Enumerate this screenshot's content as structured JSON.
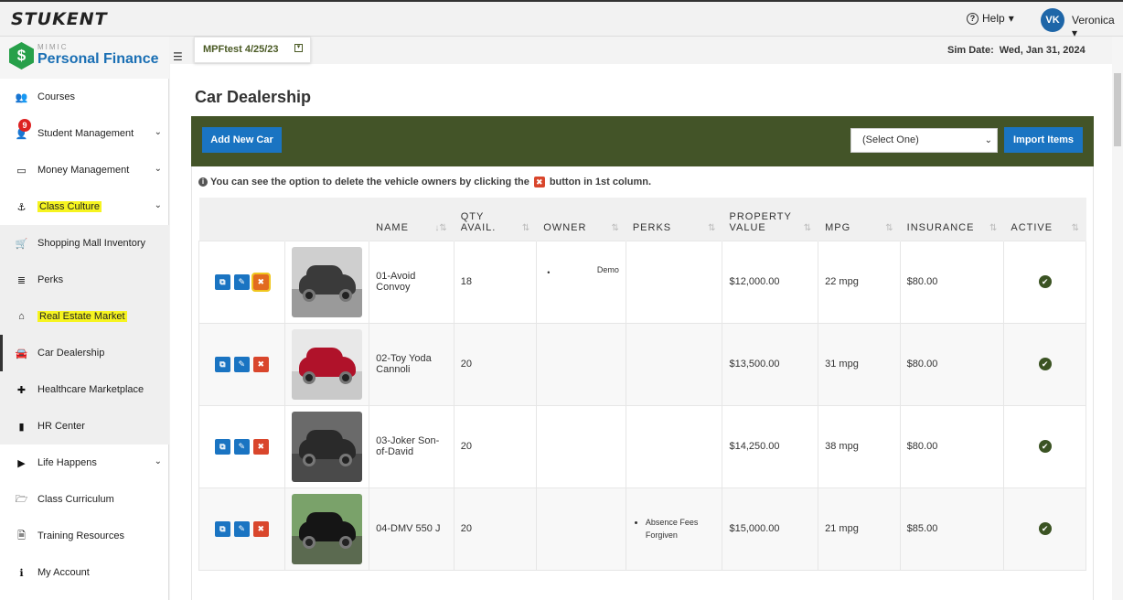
{
  "app": {
    "logo": "STUKENT",
    "brand_small": "MIMIC",
    "brand_name": "Personal Finance",
    "dollar": "$"
  },
  "header": {
    "help_label": "Help",
    "help_chev": "▾",
    "avatar_initials": "VK",
    "user_name": "Veronica",
    "user_chev": "▾"
  },
  "sidebar": {
    "items": [
      {
        "label": "Courses",
        "icon": "users-icon",
        "glyph": "👥"
      },
      {
        "label": "Student Management",
        "icon": "user-icon",
        "glyph": "👤",
        "badge": "9",
        "chevron": "⌄"
      },
      {
        "label": "Money Management",
        "icon": "money-icon",
        "glyph": "▭",
        "chevron": "⌄"
      },
      {
        "label": "Class Culture",
        "icon": "anchor-icon",
        "glyph": "⚓",
        "chevron": "⌄",
        "highlighted": true
      },
      {
        "label": "Shopping Mall Inventory",
        "icon": "cart-icon",
        "glyph": "🛒"
      },
      {
        "label": "Perks",
        "icon": "database-icon",
        "glyph": "≣"
      },
      {
        "label": "Real Estate Market",
        "icon": "home-icon",
        "glyph": "⌂",
        "highlighted": true
      },
      {
        "label": "Car Dealership",
        "icon": "car-icon",
        "glyph": "🚘",
        "active": true
      },
      {
        "label": "Healthcare Marketplace",
        "icon": "medkit-icon",
        "glyph": "✚"
      },
      {
        "label": "HR Center",
        "icon": "book-icon",
        "glyph": "▮"
      },
      {
        "label": "Life Happens",
        "icon": "play-circle-icon",
        "glyph": "▶",
        "chevron": "⌄"
      },
      {
        "label": "Class Curriculum",
        "icon": "folder-open-icon",
        "glyph": "🗁"
      },
      {
        "label": "Training Resources",
        "icon": "file-icon",
        "glyph": "🗎"
      },
      {
        "label": "My Account",
        "icon": "info-circle-icon",
        "glyph": "ℹ"
      }
    ]
  },
  "sim": {
    "name": "MPFtest 4/25/23",
    "date_label": "Sim Date:",
    "date_value": "Wed, Jan 31, 2024"
  },
  "page": {
    "title": "Car Dealership"
  },
  "toolbar": {
    "add_label": "Add New Car",
    "select_value": "(Select One)",
    "import_label": "Import Items"
  },
  "info": {
    "text_before": "You can see the option to delete the vehicle owners by clicking the",
    "text_after": "button in 1st column."
  },
  "table": {
    "headers": [
      "NAME",
      "QTY AVAIL.",
      "OWNER",
      "PERKS",
      "PROPERTY VALUE",
      "MPG",
      "INSURANCE",
      "ACTIVE"
    ],
    "rows": [
      {
        "name": "01-Avoid Convoy",
        "qty": "18",
        "owner": "Demo",
        "perks": "",
        "value": "$12,000.00",
        "mpg": "22 mpg",
        "insurance": "$80.00",
        "active": "✔",
        "car_color": "#3a3a3a",
        "sky": "#cfcfcf",
        "ground": "#9a9a9a"
      },
      {
        "name": "02-Toy Yoda Cannoli",
        "qty": "20",
        "owner": "",
        "perks": "",
        "value": "$13,500.00",
        "mpg": "31 mpg",
        "insurance": "$80.00",
        "active": "✔",
        "car_color": "#b0122a",
        "sky": "#e8e8e8",
        "ground": "#c9c9c9"
      },
      {
        "name": "03-Joker Son-of-David",
        "qty": "20",
        "owner": "",
        "perks": "",
        "value": "$14,250.00",
        "mpg": "38 mpg",
        "insurance": "$80.00",
        "active": "✔",
        "car_color": "#2a2a2a",
        "sky": "#6a6a6a",
        "ground": "#4a4a4a"
      },
      {
        "name": "04-DMV 550 J",
        "qty": "20",
        "owner": "",
        "perks": "Absence Fees Forgiven",
        "value": "$15,000.00",
        "mpg": "21 mpg",
        "insurance": "$85.00",
        "active": "✔",
        "car_color": "#151515",
        "sky": "#7aa26a",
        "ground": "#5b6a50"
      }
    ]
  }
}
